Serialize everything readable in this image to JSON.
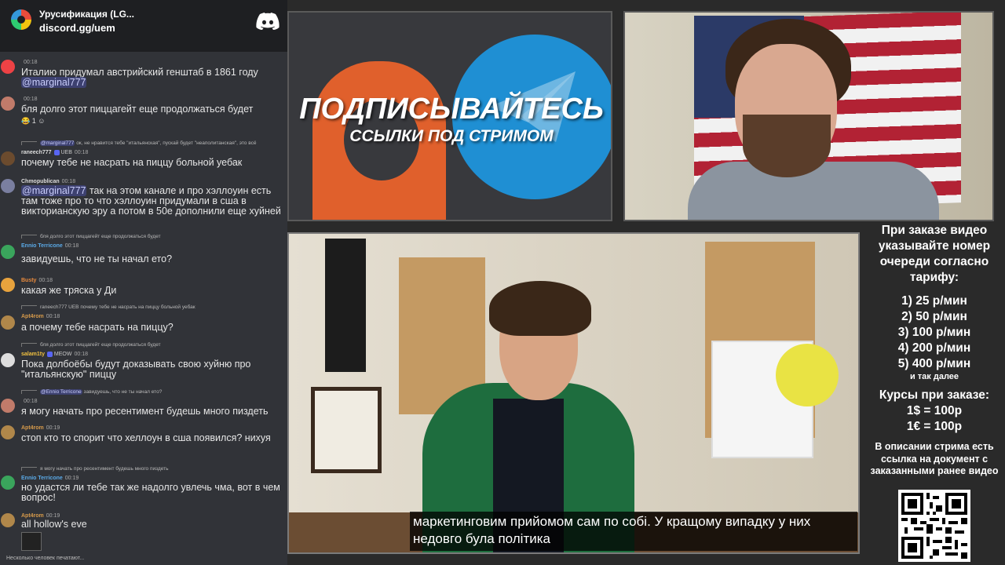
{
  "chat": {
    "header": {
      "server_name": "Урусификация (LG...",
      "server_link": "discord.gg/uem",
      "logo_icon": "discord-icon"
    },
    "messages": [
      {
        "author": "",
        "time": "00:18",
        "text": "Италию придумал австрийский генштаб в 1861 году",
        "mention": "@marginal777",
        "avatar_color": "#ed4245"
      },
      {
        "author": "",
        "time": "00:18",
        "text": "бля долго этот пиццагейт еще продолжаться будет",
        "reaction_count": "1",
        "avatar_color": "#c17b6a"
      },
      {
        "reply_mention": "@marginal777",
        "reply_text": "ок, не нравится тебе \"итальянская\", пускай будет \"неаполитанская\", это всё",
        "author": "raneech777",
        "badge": "UEB",
        "time": "00:18",
        "text": "почему тебе не насрать на пиццу больной уебак",
        "avatar_color": "#6b4b2e"
      },
      {
        "author": "Chmopublican",
        "time": "00:18",
        "mention": "@marginal777",
        "text": "так на этом канале и про хэллоуин есть там тоже про то что хэллоуин придумали в сша в викторианскую эру а потом в 50е дополнили еще хуйней",
        "avatar_color": "#7a7fa0"
      },
      {
        "reply_text": "бля долго этот пиццагейт еще продолжаться будет",
        "author": "Ennio Terricone",
        "time": "00:18",
        "text": "завидуешь, что не ты начал ето?",
        "avatar_color": "#3aa55c"
      },
      {
        "author": "Busty",
        "time": "00:18",
        "text": "какая же тряска у Ди",
        "avatar_color": "#e8a33d"
      },
      {
        "reply_text": "почему тебе не насрать на пиццу больной уебак",
        "reply_author": "raneech777",
        "reply_badge": "UEB",
        "author": "Apt4rom",
        "time": "00:18",
        "text": "а почему тебе насрать на пиццу?",
        "avatar_color": "#b0874a"
      },
      {
        "reply_text": "бля долго этот пиццагейт еще продолжаться будет",
        "author": "salam1ty",
        "badge": "MEOW",
        "time": "00:18",
        "text": "Пока долбоёбы будут доказывать свою хуйню про \"итальянскую\" пиццу",
        "avatar_color": "#dddddd"
      },
      {
        "reply_mention": "@Ennio Terricone",
        "reply_text": "завидуешь, что не ты начал ето?",
        "author": "",
        "time": "00:18",
        "text": "я могу начать про ресентимент будешь много пиздеть",
        "avatar_color": "#c17b6a"
      },
      {
        "author": "Apt4rom",
        "time": "00:19",
        "text": "стоп кто то спорит что хеллоун в сша появился? нихуя",
        "avatar_color": "#b0874a"
      },
      {
        "reply_text": "я могу начать про ресентимент будешь много пиздеть",
        "author": "Ennio Terricone",
        "time": "00:19",
        "text": "но удастся ли тебе так же надолго увлечь чма, вот в чем вопрос!",
        "avatar_color": "#3aa55c"
      },
      {
        "author": "Apt4rom",
        "time": "00:19",
        "text": "all hollow's eve",
        "avatar_color": "#b0874a"
      }
    ],
    "typing": "Несколько человек печатают..."
  },
  "promo": {
    "title": "ПОДПИСЫВАЙТЕСЬ",
    "subtitle": "ССЫЛКИ ПОД СТРИМОМ",
    "icons": [
      "patreon-icon",
      "telegram-icon"
    ],
    "colors": {
      "patreon": "#e0602c",
      "telegram": "#1f8fd3"
    }
  },
  "video": {
    "subtitle_line1": "маркетинговим прийомом сам по собі. У кращому випадку у них",
    "subtitle_line2": "недовго була політика"
  },
  "info": {
    "heading": "При заказе видео указывайте номер очереди согласно тарифу:",
    "prices": [
      "1) 25 р/мин",
      "2) 50 р/мин",
      "3) 100 р/мин",
      "4) 200 р/мин",
      "5) 400 р/мин"
    ],
    "prices_more": "и так далее",
    "courses_title": "Курсы при заказе:",
    "courses": [
      "1$ = 100р",
      "1€ = 100р"
    ],
    "description": "В описании стрима есть ссылка на документ с заказанными ранее видео",
    "qr_icon": "qr-code-icon"
  }
}
